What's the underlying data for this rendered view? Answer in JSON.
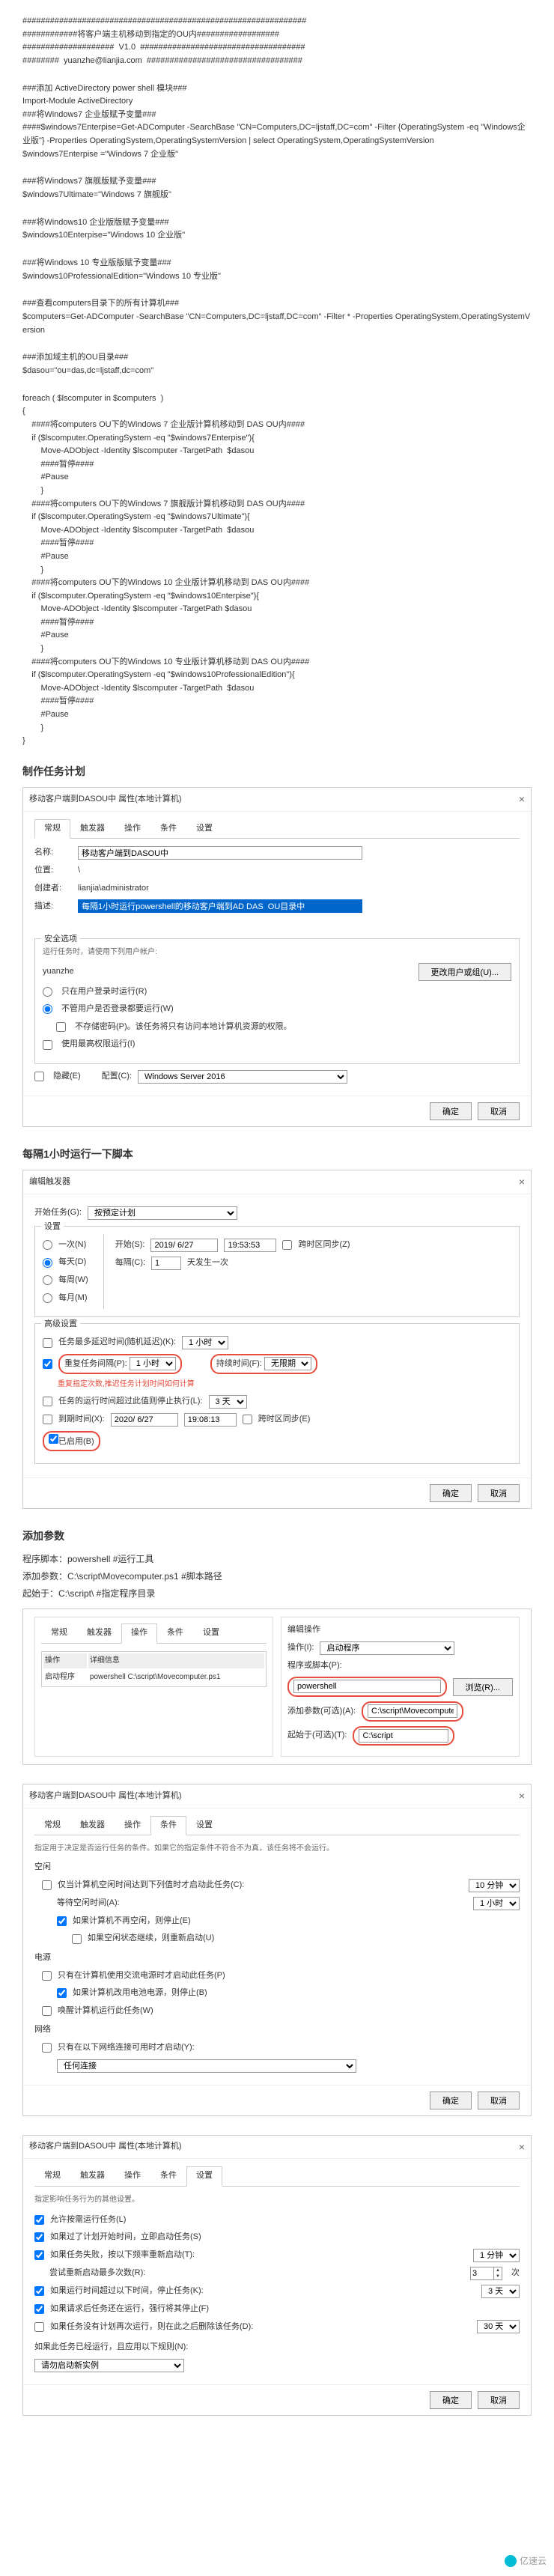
{
  "script": {
    "header1": "##############################################################",
    "header2": "############将客户端主机移动到指定的OU内##################",
    "header3": "####################  V1.0  ####################################",
    "header4": "########  yuanzhe@lianjia.com  ##################################",
    "mod_comment": "###添加 ActiveDirectory power shell 模块###",
    "mod_cmd": "Import-Module ActiveDirectory",
    "win7e_comment": "###将Windows7 企业版赋予变量###",
    "win7e_cmd": "####$windows7Enterpise=Get-ADComputer -SearchBase \"CN=Computers,DC=ljstaff,DC=com\" -Filter {OperatingSystem -eq \"Windows企业版\"} -Properties OperatingSystem,OperatingSystemVersion | select OperatingSystem,OperatingSystemVersion",
    "win7e_assign": "$windows7Enterpise =\"Windows 7 企业版\"",
    "win7u_comment": "###将Windows7 旗舰版赋予变量###",
    "win7u_assign": "$windows7Ultimate=\"Windows 7 旗舰版\"",
    "win10e_comment": "###将Windows10 企业版版赋予变量###",
    "win10e_assign": "$windows10Enterpise=\"Windows 10 企业版\"",
    "win10p_comment": "###将Windows 10 专业版版赋予变量###",
    "win10p_assign": "$windows10ProfessionalEdition=\"Windows 10 专业版\"",
    "list_comment": "###查看computers目录下的所有计算机###",
    "list_cmd": "$computers=Get-ADComputer -SearchBase \"CN=Computers,DC=ljstaff,DC=com\" -Filter * -Properties OperatingSystem,OperatingSystemVersion",
    "ou_comment": "###添加域主机的OU目录###",
    "ou_assign": "$dasou=\"ou=das,dc=ljstaff,dc=com\"",
    "foreach": "foreach ( $lscomputer in $computers  )",
    "brace_open": "{",
    "c1": "    ####将computers OU下的Windows 7 企业版计算机移动到 DAS OU内####",
    "if1": "    if ($lscomputer.OperatingSystem -eq \"$windows7Enterpise\"){",
    "move1": "        Move-ADObject -Identity $lscomputer -TargetPath  $dasou",
    "pause_c": "        ####暂停####",
    "pause": "        #Pause",
    "brace_c": "        }",
    "c2": "    ####将computers OU下的Windows 7 旗舰版计算机移动到 DAS OU内####",
    "if2": "    if ($lscomputer.OperatingSystem -eq \"$windows7Ultimate\"){",
    "c3": "    ####将computers OU下的Windows 10 企业版计算机移动到 DAS OU内####",
    "if3": "    if ($lscomputer.OperatingSystem -eq \"$windows10Enterpise\"){",
    "move3": "        Move-ADObject -Identity $lscomputer -TargetPath $dasou",
    "c4": "    ####将computers OU下的Windows 10 专业版计算机移动到 DAS OU内####",
    "if4": "    if ($lscomputer.OperatingSystem -eq \"$windows10ProfessionalEdition\"){",
    "brace_end": "}"
  },
  "sec1_title": "制作任务计划",
  "dialog1": {
    "title": "移动客户端到DASOU中 属性(本地计算机)",
    "tabs": [
      "常规",
      "触发器",
      "操作",
      "条件",
      "设置"
    ],
    "name_label": "名称:",
    "name_value": "移动客户端到DASOU中",
    "location_label": "位置:",
    "location_value": "\\",
    "author_label": "创建者:",
    "author_value": "lianjia\\administrator",
    "desc_label": "描述:",
    "desc_value": "每隔1小时运行powershell的移动客户端到AD DAS  OU目录中",
    "security_title": "安全选项",
    "security_sub": "运行任务时，请使用下列用户帐户:",
    "security_user": "yuanzhe",
    "change_user_btn": "更改用户或组(U)...",
    "radio1": "只在用户登录时运行(R)",
    "radio2": "不管用户是否登录都要运行(W)",
    "cb1": "不存储密码(P)。该任务将只有访问本地计算机资源的权限。",
    "cb2": "使用最高权限运行(I)",
    "cb3": "隐藏(E)",
    "config_label": "配置(C):",
    "config_value": "Windows Server 2016",
    "ok": "确定",
    "cancel": "取消"
  },
  "sec2_title": "每隔1小时运行一下脚本",
  "dialog2": {
    "title": "编辑触发器",
    "begin_label": "开始任务(G):",
    "begin_value": "按预定计划",
    "settings_title": "设置",
    "once": "一次(N)",
    "daily": "每天(D)",
    "weekly": "每周(W)",
    "monthly": "每月(M)",
    "start_label": "开始(S):",
    "date": "2019/ 6/27",
    "time": "19:53:53",
    "sync": "跨时区同步(Z)",
    "every_label": "每隔(C):",
    "every_value": "1",
    "every_unit": "天发生一次",
    "adv_title": "高级设置",
    "delay_cb": "任务最多延迟时间(随机延迟)(K):",
    "delay_val": "1 小时",
    "repeat_cb": "重复任务间隔(P):",
    "repeat_val": "1 小时",
    "duration_label": "持续时间(F):",
    "duration_val": "无限期",
    "repeat_note": "重复指定次数,推迟任务计划时间如何计算",
    "stop_cb": "任务的运行时间超过此值则停止执行(L):",
    "stop_val": "3 天",
    "expire_cb": "到期时间(X):",
    "expire_date": "2020/ 6/27",
    "expire_time": "19:08:13",
    "expire_sync": "跨时区同步(E)",
    "enabled_cb": "已启用(B)"
  },
  "sec3_title": "添加参数",
  "para1": "程序脚本：powershell    #运行工具",
  "para2": "添加参数：C:\\script\\Movecomputer.ps1   #脚本路径",
  "para3": "起始于：C:\\script\\ #指定程序目录",
  "dialog3": {
    "title": "编辑操作",
    "action_label": "操作(I):",
    "action_value": "启动程序",
    "prog_label": "程序或脚本(P):",
    "prog_value": "powershell",
    "browse": "浏览(R)...",
    "args_label": "添加参数(可选)(A):",
    "args_value": "C:\\script\\Movecomputer.ps1",
    "start_label": "起始于(可选)(T):",
    "start_value": "C:\\script"
  },
  "dialog4": {
    "title": "移动客户端到DASOU中 属性(本地计算机)",
    "desc": "指定用于决定是否运行任务的条件。如果它的指定条件不符合不为真，该任务将不会运行。",
    "idle_title": "空闲",
    "idle_cb": "仅当计算机空闲时间达到下列值时才启动此任务(C):",
    "idle_val": "10 分钟",
    "wait_label": "等待空闲时间(A):",
    "wait_val": "1 小时",
    "stop_idle": "如果计算机不再空闲，则停止(E)",
    "restart_idle": "如果空闲状态继续，则重新启动(U)",
    "power_title": "电源",
    "ac_cb": "只有在计算机使用交流电源时才启动此任务(P)",
    "battery_cb": "如果计算机改用电池电源，则停止(B)",
    "wake_cb": "唤醒计算机运行此任务(W)",
    "net_title": "网络",
    "net_cb": "只有在以下网络连接可用时才启动(Y):",
    "net_val": "任何连接"
  },
  "dialog5": {
    "title": "移动客户端到DASOU中 属性(本地计算机)",
    "desc": "指定影响任务行为的其他设置。",
    "s1": "允许按需运行任务(L)",
    "s2": "如果过了计划开始时间，立即启动任务(S)",
    "s3": "如果任务失败，按以下频率重新启动(T):",
    "s3_val": "1 分钟",
    "s3_retry": "尝试重新启动最多次数(R):",
    "s3_retry_val": "3",
    "s3_retry_unit": "次",
    "s4": "如果运行时间超过以下时间，停止任务(K):",
    "s4_val": "3 天",
    "s5": "如果请求后任务还在运行，强行将其停止(F)",
    "s6": "如果任务没有计划再次运行，则在此之后删除该任务(D):",
    "s6_val": "30 天",
    "s7": "如果此任务已经运行，且应用以下规则(N):",
    "s7_val": "请勿启动新实例"
  },
  "footer": "亿速云"
}
